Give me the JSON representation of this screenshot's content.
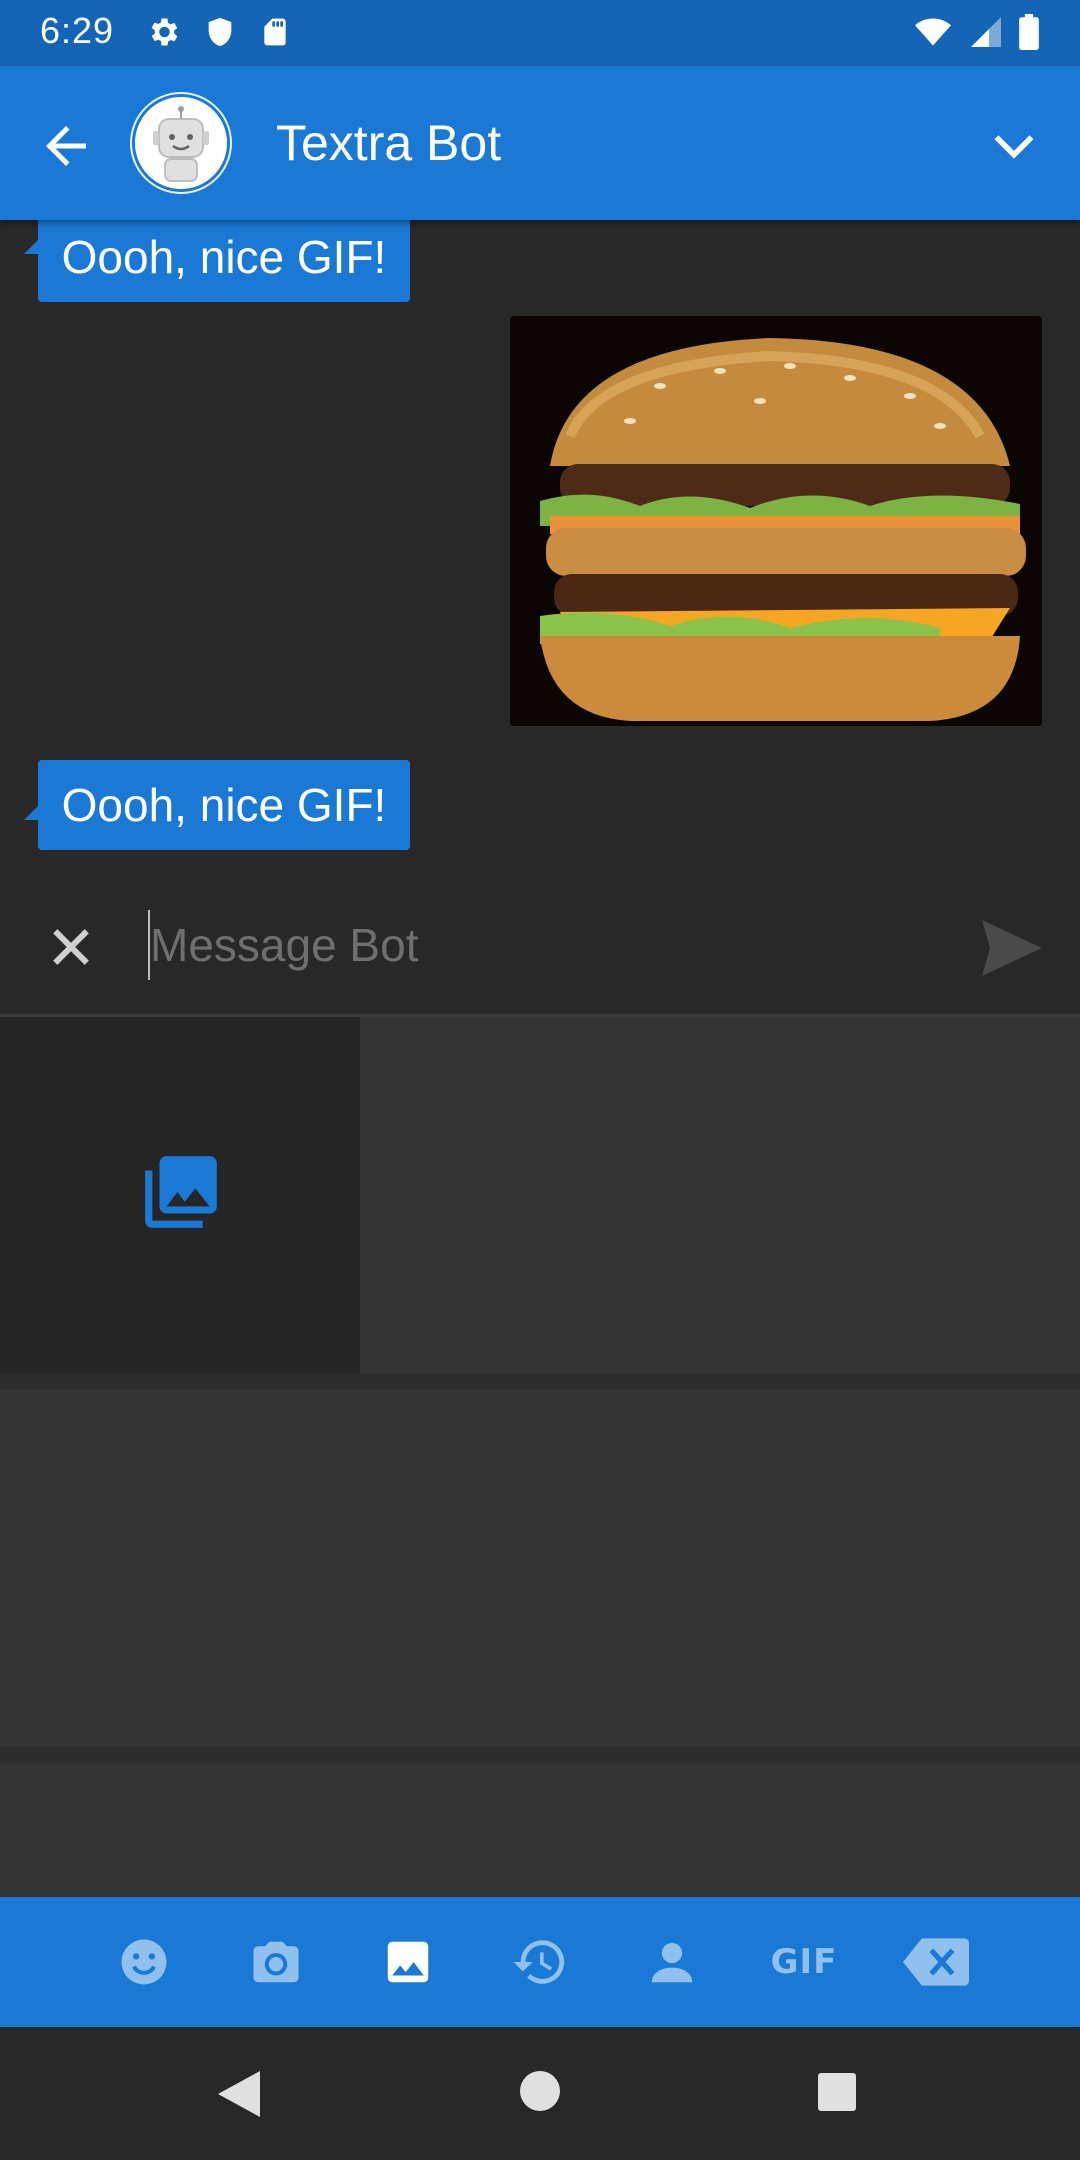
{
  "status_bar": {
    "time": "6:29",
    "left_icons": [
      "settings-icon",
      "shield-icon",
      "sd-card-icon"
    ],
    "right_icons": [
      "wifi-icon",
      "cell-signal-icon",
      "battery-icon"
    ]
  },
  "app_bar": {
    "contact_name": "Textra Bot",
    "back_icon": "arrow-back-icon",
    "expand_icon": "chevron-down-icon"
  },
  "messages": [
    {
      "type": "incoming",
      "text": "Oooh, nice GIF!"
    },
    {
      "type": "outgoing_image",
      "description_icon": "gif-burger-image"
    },
    {
      "type": "incoming",
      "text": "Oooh, nice GIF!"
    }
  ],
  "compose": {
    "placeholder": "Message Bot",
    "value": ""
  },
  "tabs": [
    {
      "name": "emoji-icon",
      "active": false
    },
    {
      "name": "camera-icon",
      "active": false
    },
    {
      "name": "gallery-icon",
      "active": true
    },
    {
      "name": "recent-icon",
      "active": false
    },
    {
      "name": "contact-icon",
      "active": false
    },
    {
      "name": "gif-tab",
      "label": "GIF",
      "active": false
    },
    {
      "name": "backspace-icon",
      "active": false
    }
  ],
  "colors": {
    "accent": "#1a79d4",
    "status_bar": "#1565b7",
    "background": "#282828",
    "tab_inactive": "#8fc0ee",
    "tab_active": "#ffffff"
  }
}
